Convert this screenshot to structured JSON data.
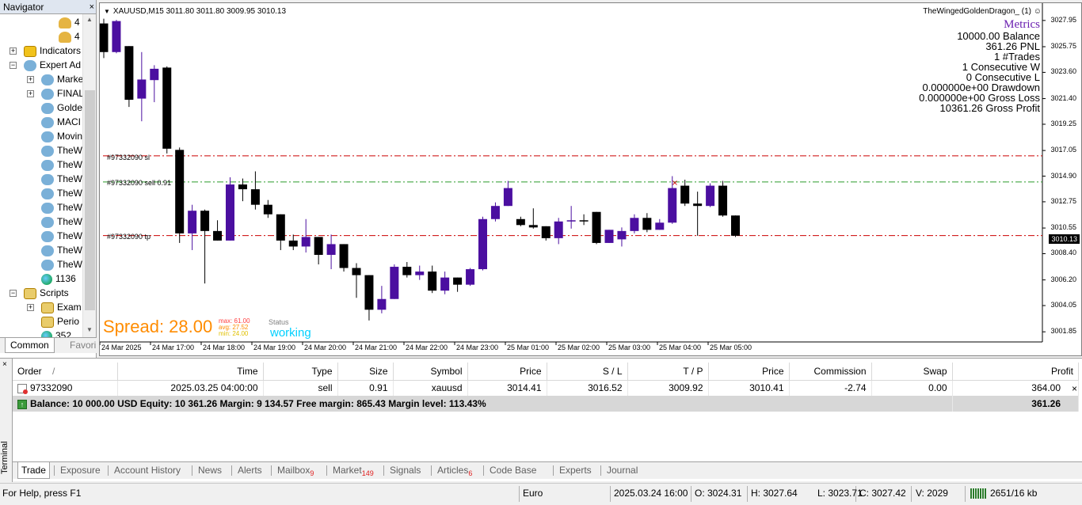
{
  "navigator": {
    "title": "Navigator",
    "close": "×",
    "items": [
      {
        "label": "4",
        "icon": "account-icon",
        "level": 3,
        "expander": ""
      },
      {
        "label": "4",
        "icon": "account-icon",
        "level": 3,
        "expander": ""
      },
      {
        "label": "Indicators",
        "icon": "indicator-icon",
        "level": 1,
        "expander": "+"
      },
      {
        "label": "Expert Ad",
        "icon": "expert-advisor-icon",
        "level": 1,
        "expander": "−"
      },
      {
        "label": "Marke",
        "icon": "expert-advisor-icon",
        "level": 2,
        "expander": "+"
      },
      {
        "label": "FINAL",
        "icon": "expert-advisor-icon",
        "level": 2,
        "expander": "+"
      },
      {
        "label": "Golde",
        "icon": "expert-advisor-icon",
        "level": 2,
        "expander": ""
      },
      {
        "label": "MACI",
        "icon": "expert-advisor-icon",
        "level": 2,
        "expander": ""
      },
      {
        "label": "Movin",
        "icon": "expert-advisor-icon",
        "level": 2,
        "expander": ""
      },
      {
        "label": "TheW",
        "icon": "expert-advisor-icon",
        "level": 2,
        "expander": ""
      },
      {
        "label": "TheW",
        "icon": "expert-advisor-icon",
        "level": 2,
        "expander": ""
      },
      {
        "label": "TheW",
        "icon": "expert-advisor-icon",
        "level": 2,
        "expander": ""
      },
      {
        "label": "TheW",
        "icon": "expert-advisor-icon",
        "level": 2,
        "expander": ""
      },
      {
        "label": "TheW",
        "icon": "expert-advisor-icon",
        "level": 2,
        "expander": ""
      },
      {
        "label": "TheW",
        "icon": "expert-advisor-icon",
        "level": 2,
        "expander": ""
      },
      {
        "label": "TheW",
        "icon": "expert-advisor-icon",
        "level": 2,
        "expander": ""
      },
      {
        "label": "TheW",
        "icon": "expert-advisor-icon",
        "level": 2,
        "expander": ""
      },
      {
        "label": "TheW",
        "icon": "expert-advisor-icon",
        "level": 2,
        "expander": ""
      },
      {
        "label": "1136",
        "icon": "market-globe-icon",
        "level": 2,
        "expander": ""
      },
      {
        "label": "Scripts",
        "icon": "script-icon",
        "level": 1,
        "expander": "−"
      },
      {
        "label": "Exam",
        "icon": "script-icon",
        "level": 2,
        "expander": "+"
      },
      {
        "label": "Perio",
        "icon": "script-icon",
        "level": 2,
        "expander": ""
      },
      {
        "label": "352",
        "icon": "market-globe-icon",
        "level": 2,
        "expander": ""
      }
    ],
    "tabs": [
      "Common",
      "Favori"
    ]
  },
  "chart": {
    "title": "XAUUSD,M15  3011.80 3011.80 3009.95 3010.13",
    "ea_name": "TheWingedGoldenDragon_  (1)",
    "metrics": {
      "title": "Metrics",
      "lines": [
        "10000.00 Balance",
        "361.26 PNL",
        "1 #Trades",
        "1 Consecutive W",
        "0 Consecutive L",
        "0.000000e+00 Drawdown",
        "0.000000e+00 Gross Loss",
        "10361.26 Gross Profit"
      ]
    },
    "sl_label": "#97332090 sl",
    "entry_label": "#97332090 sell 0.91",
    "tp_label": "#97332090 tp",
    "spread_label": "Spread: 28.00",
    "spread_stats": {
      "max": "max: 61.00",
      "avg": "avg: 27.52",
      "min": "min: 24.00"
    },
    "status_label": "Status",
    "status_value": "working",
    "current_price": "3010.13",
    "colors": {
      "bull": "#4b0fa0",
      "bear": "#000000",
      "sl_tp": "#cc0000",
      "entry": "#2a9a2a",
      "spread": "#ff8c00",
      "status": "#00d0ff",
      "metrics_title": "#6a1fb0"
    }
  },
  "chart_data": {
    "type": "candlestick",
    "symbol": "XAUUSD",
    "timeframe": "M15",
    "y_ticks": [
      "3027.95",
      "3025.75",
      "3023.60",
      "3021.40",
      "3019.25",
      "3017.05",
      "3014.90",
      "3012.75",
      "3010.55",
      "3008.40",
      "3006.20",
      "3004.05",
      "3001.85"
    ],
    "x_ticks": [
      "24 Mar 2025",
      "24 Mar 17:00",
      "24 Mar 18:00",
      "24 Mar 19:00",
      "24 Mar 20:00",
      "24 Mar 21:00",
      "24 Mar 22:00",
      "24 Mar 23:00",
      "25 Mar 01:00",
      "25 Mar 02:00",
      "25 Mar 03:00",
      "25 Mar 04:00",
      "25 Mar 05:00"
    ],
    "ylim": [
      1.0,
      29.4
    ],
    "y_base": 3000,
    "candles": [
      [
        27.7,
        28.1,
        24.8,
        25.3
      ],
      [
        25.3,
        28.0,
        25.2,
        27.9
      ],
      [
        25.8,
        25.8,
        20.7,
        21.3
      ],
      [
        21.4,
        25.3,
        19.5,
        23.0
      ],
      [
        22.95,
        24.2,
        21.1,
        23.9
      ],
      [
        24.0,
        24.1,
        16.8,
        17.2
      ],
      [
        17.1,
        17.3,
        9.3,
        10.1
      ],
      [
        10.1,
        12.5,
        8.7,
        12.0
      ],
      [
        12.0,
        12.1,
        5.9,
        10.3
      ],
      [
        10.3,
        11.2,
        9.5,
        9.5
      ],
      [
        9.5,
        14.8,
        9.5,
        14.2
      ],
      [
        14.2,
        14.7,
        12.8,
        13.8
      ],
      [
        13.8,
        15.3,
        12.1,
        12.5
      ],
      [
        12.5,
        12.9,
        11.4,
        11.7
      ],
      [
        11.7,
        11.7,
        8.7,
        9.5
      ],
      [
        9.5,
        10.0,
        8.7,
        9.0
      ],
      [
        9.0,
        11.3,
        8.5,
        9.8
      ],
      [
        9.8,
        9.8,
        7.5,
        8.3
      ],
      [
        8.3,
        10.0,
        7.1,
        9.2
      ],
      [
        9.2,
        9.2,
        6.9,
        7.2
      ],
      [
        7.2,
        7.6,
        4.7,
        6.6
      ],
      [
        6.6,
        6.6,
        2.8,
        3.7
      ],
      [
        3.7,
        5.7,
        3.4,
        4.6
      ],
      [
        4.6,
        7.5,
        4.6,
        7.3
      ],
      [
        7.3,
        7.7,
        6.4,
        6.6
      ],
      [
        6.6,
        7.4,
        6.2,
        6.9
      ],
      [
        6.9,
        7.4,
        5.1,
        5.3
      ],
      [
        5.3,
        6.9,
        5.0,
        6.4
      ],
      [
        6.4,
        6.4,
        5.2,
        5.8
      ],
      [
        5.8,
        7.2,
        5.7,
        7.1
      ],
      [
        7.1,
        11.5,
        7.0,
        11.3
      ],
      [
        11.3,
        12.7,
        11.1,
        12.4
      ],
      [
        12.4,
        14.5,
        12.4,
        13.9
      ],
      [
        11.3,
        11.5,
        10.7,
        10.8
      ],
      [
        10.8,
        12.2,
        10.5,
        10.6
      ],
      [
        10.7,
        10.7,
        9.5,
        9.7
      ],
      [
        9.7,
        11.4,
        9.2,
        11.1
      ],
      [
        11.1,
        12.4,
        10.5,
        11.2
      ],
      [
        11.2,
        11.7,
        10.8,
        11.1
      ],
      [
        11.9,
        11.9,
        9.2,
        9.3
      ],
      [
        9.3,
        10.4,
        9.3,
        10.4
      ],
      [
        9.6,
        10.6,
        9.0,
        10.3
      ],
      [
        10.3,
        11.7,
        10.1,
        11.4
      ],
      [
        11.4,
        11.8,
        10.2,
        10.4
      ],
      [
        10.4,
        11.3,
        10.4,
        11.0
      ],
      [
        11.0,
        14.9,
        10.9,
        13.9
      ],
      [
        14.1,
        14.6,
        12.4,
        12.6
      ],
      [
        12.6,
        13.6,
        9.9,
        12.4
      ],
      [
        12.4,
        14.3,
        12.3,
        14.1
      ],
      [
        14.1,
        14.5,
        11.5,
        11.6
      ],
      [
        11.6,
        11.6,
        9.8,
        9.9
      ]
    ],
    "sl": 16.6,
    "entry": 14.41,
    "tp": 9.92
  },
  "terminal": {
    "side_label": "Terminal",
    "close": "×",
    "columns": [
      "Order",
      "Time",
      "Type",
      "Size",
      "Symbol",
      "Price",
      "S / L",
      "T / P",
      "Price",
      "Commission",
      "Swap",
      "Profit"
    ],
    "sort_marker": "/",
    "row": [
      "97332090",
      "2025.03.25 04:00:00",
      "sell",
      "0.91",
      "xauusd",
      "3014.41",
      "3016.52",
      "3009.92",
      "3010.41",
      "-2.74",
      "0.00",
      "364.00"
    ],
    "row_close": "×",
    "balance_text": "Balance: 10 000.00 USD  Equity: 10 361.26  Margin: 9 134.57  Free margin: 865.43  Margin level: 113.43%",
    "balance_profit": "361.26",
    "tabs": [
      {
        "label": "Trade",
        "badge": ""
      },
      {
        "label": "Exposure",
        "badge": ""
      },
      {
        "label": "Account History",
        "badge": ""
      },
      {
        "label": "News",
        "badge": ""
      },
      {
        "label": "Alerts",
        "badge": ""
      },
      {
        "label": "Mailbox",
        "badge": "9"
      },
      {
        "label": "Market",
        "badge": "149"
      },
      {
        "label": "Signals",
        "badge": ""
      },
      {
        "label": "Articles",
        "badge": "6"
      },
      {
        "label": "Code Base",
        "badge": ""
      },
      {
        "label": "Experts",
        "badge": ""
      },
      {
        "label": "Journal",
        "badge": ""
      }
    ]
  },
  "statusbar": {
    "help": "For Help, press F1",
    "profile": "Euro",
    "time": "2025.03.24 16:00",
    "open": "O: 3024.31",
    "high": "H: 3027.64",
    "low": "L: 3023.71",
    "close": "C: 3027.42",
    "volume": "V: 2029",
    "traffic": "2651/16 kb"
  }
}
